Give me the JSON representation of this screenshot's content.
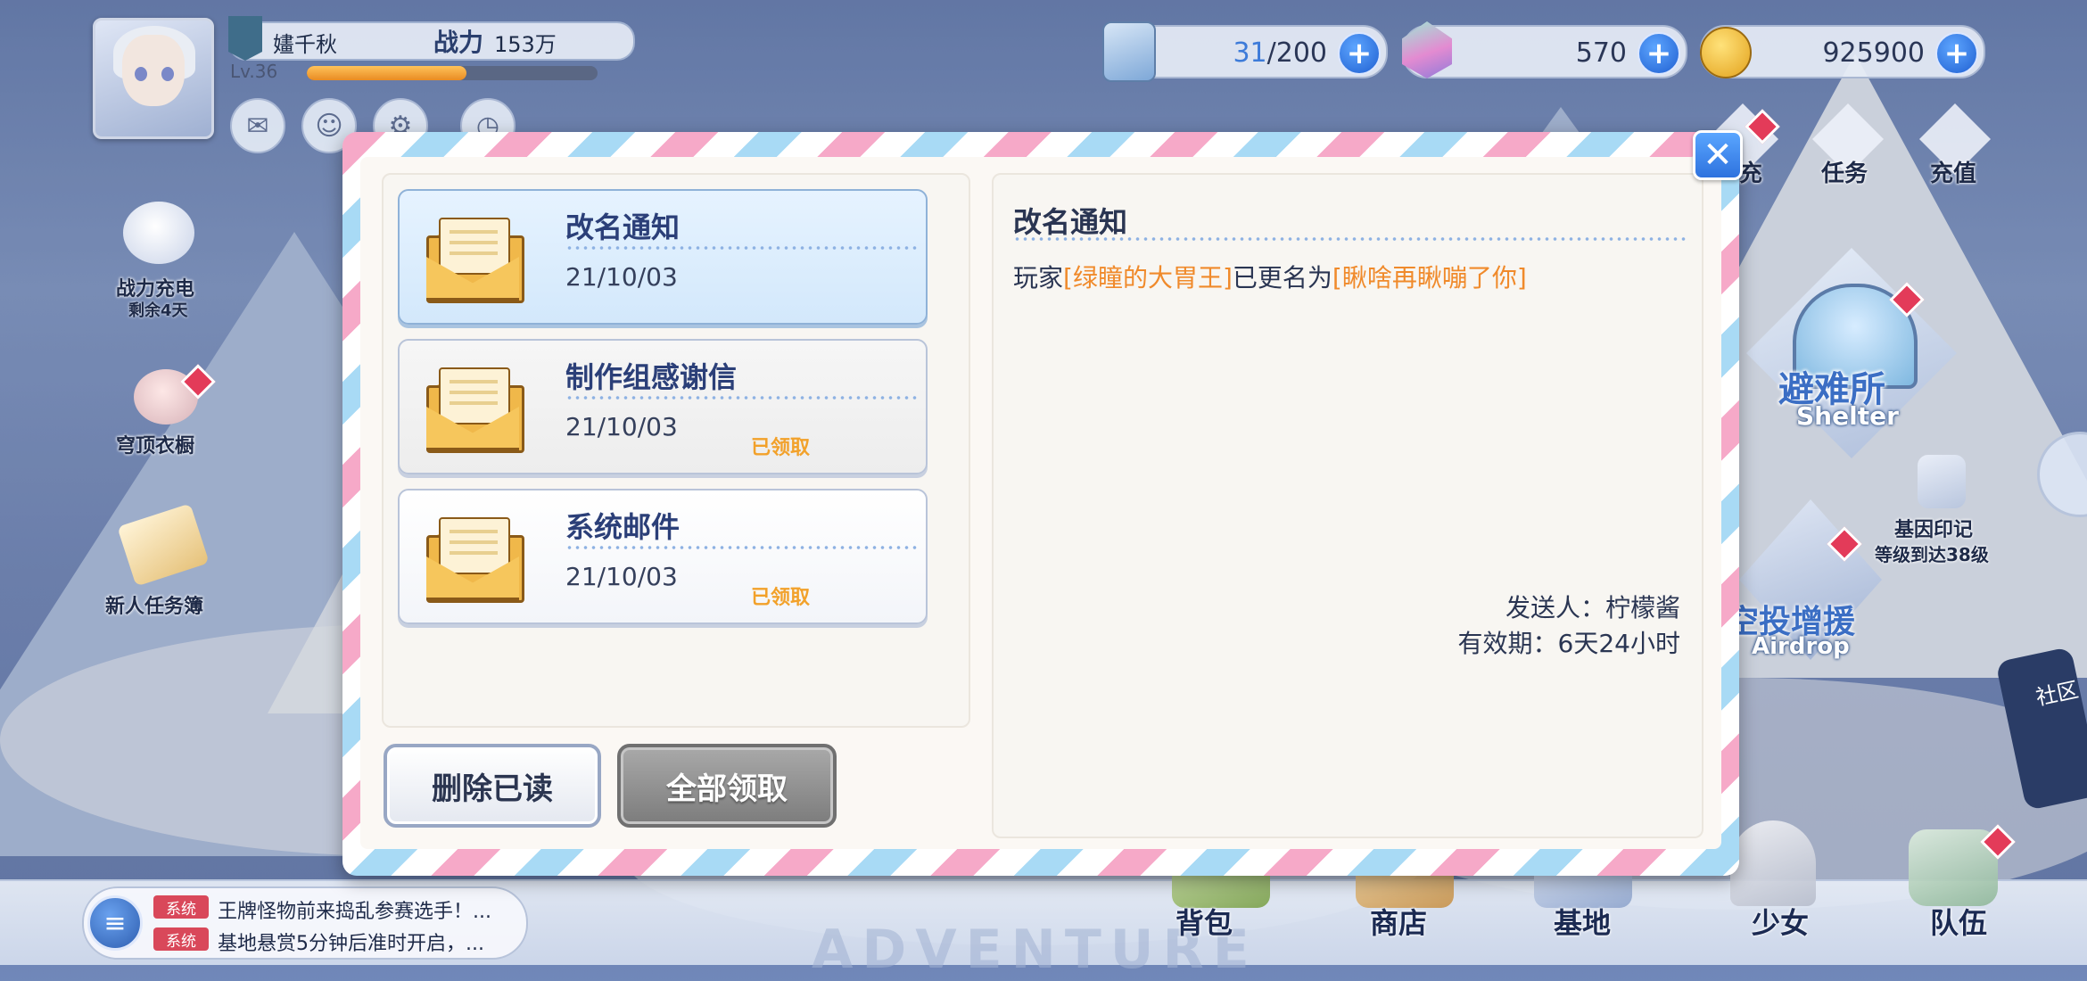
{
  "player": {
    "name": "嫿千秋",
    "power_label": "战力",
    "power_value": "153万",
    "level": "Lv.36",
    "exp_fraction": 0.55
  },
  "resources": [
    {
      "icon": "stamina-icon",
      "current": "31",
      "max": "/200"
    },
    {
      "icon": "crystal-icon",
      "value": "570"
    },
    {
      "icon": "gold-coin-icon",
      "value": "925900"
    }
  ],
  "hud_icons": [
    "mail-icon",
    "friends-icon",
    "profile-icon",
    "clock-icon"
  ],
  "left_menu": {
    "power_charge": {
      "label": "战力充电",
      "sub": "剩余4天"
    },
    "wardrobe": {
      "label": "穹顶衣橱"
    },
    "newbie_tasks": {
      "label": "新人任务簿"
    }
  },
  "right_menu": [
    {
      "label": "充",
      "icon": "gift-icon"
    },
    {
      "label": "任务",
      "icon": "tasks-icon"
    },
    {
      "label": "充值",
      "icon": "recharge-icon"
    }
  ],
  "shelter": {
    "label_cn": "避难所",
    "label_en": "Shelter"
  },
  "airdrop": {
    "label_cn": "空投增援",
    "label_en": "Airdrop"
  },
  "gene": {
    "label": "基因印记",
    "sub": "等级到达38级"
  },
  "community": {
    "label": "社区"
  },
  "chat": {
    "messages": [
      {
        "tag": "系统",
        "text": "王牌怪物前来捣乱参赛选手！..."
      },
      {
        "tag": "系统",
        "text": "基地悬赏5分钟后准时开启，..."
      }
    ]
  },
  "bottom_nav": [
    "背包",
    "商店",
    "基地",
    "少女",
    "队伍"
  ],
  "bottom_watermark": "ADVENTURE",
  "mail_dialog": {
    "items": [
      {
        "title": "改名通知",
        "date": "21/10/03",
        "status": "",
        "selected": true
      },
      {
        "title": "制作组感谢信",
        "date": "21/10/03",
        "status": "已领取",
        "selected": false
      },
      {
        "title": "系统邮件",
        "date": "21/10/03",
        "status": "已领取",
        "selected": false
      }
    ],
    "delete_read_label": "删除已读",
    "claim_all_label": "全部领取",
    "detail": {
      "title": "改名通知",
      "body_prefix": "玩家",
      "old_name": "[绿瞳的大胃王]",
      "body_middle": "已更名为",
      "new_name": "[瞅啥再瞅嘣了你]",
      "sender": "发送人：柠檬酱",
      "expiry": "有效期：6天24小时"
    },
    "close_label": "✕"
  },
  "colors": {
    "accent_blue": "#2e72de",
    "highlight_orange": "#f08a2b",
    "claimed_orange": "#f2a12a",
    "title_navy": "#2b3f78"
  }
}
